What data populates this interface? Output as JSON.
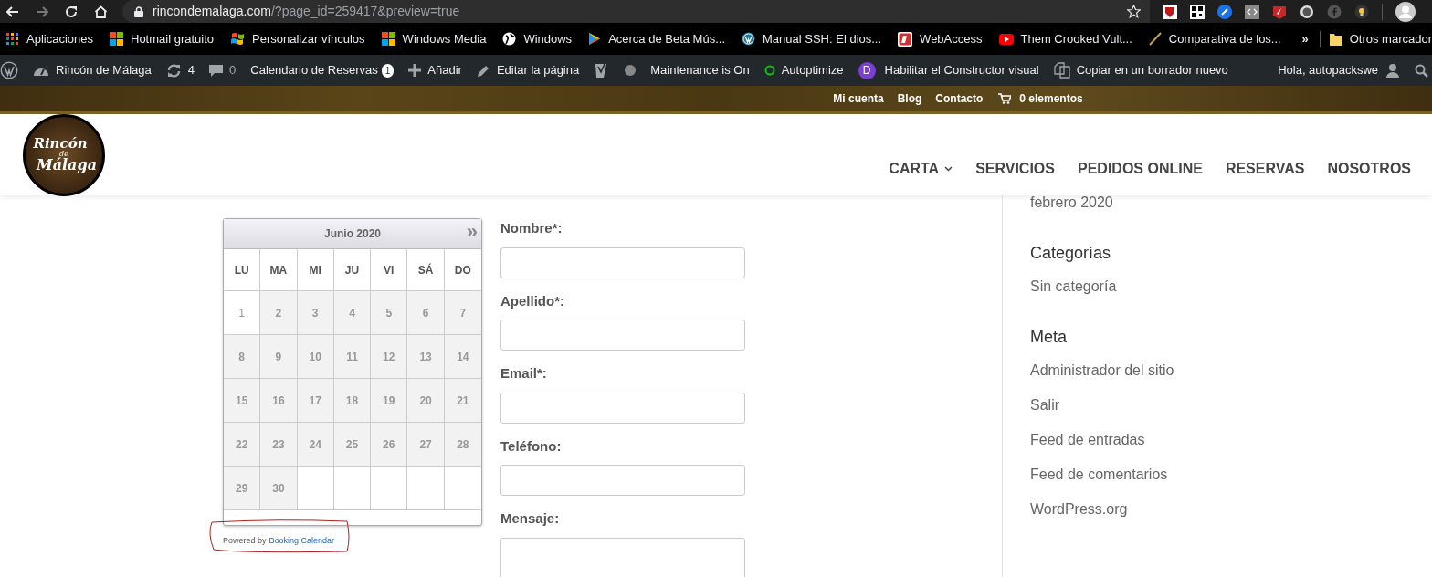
{
  "browser": {
    "url_host": "rincondemalaga.com",
    "url_path": "/?page_id=259417&preview=true",
    "bookmarks": [
      {
        "kind": "apps",
        "label": "Aplicaciones"
      },
      {
        "kind": "windows",
        "label": "Hotmail gratuito"
      },
      {
        "kind": "flag",
        "label": "Personalizar vínculos"
      },
      {
        "kind": "windows",
        "label": "Windows Media"
      },
      {
        "kind": "globe",
        "label": "Windows"
      },
      {
        "kind": "play",
        "label": "Acerca de Beta Mús..."
      },
      {
        "kind": "wp",
        "label": "Manual SSH: El dios..."
      },
      {
        "kind": "redbox",
        "label": "WebAccess"
      },
      {
        "kind": "youtube",
        "label": "Them Crooked Vult..."
      },
      {
        "kind": "slash",
        "label": "Comparativa de los..."
      }
    ],
    "more_bookmarks": "»",
    "other_bookmarks": "Otros marcador"
  },
  "admin_bar": {
    "site": "Rincón de Málaga",
    "updates": "4",
    "comments": "0",
    "calendar": "Calendario de Reservas",
    "calendar_badge": "1",
    "add": "Añadir",
    "edit": "Editar la página",
    "maintenance": "Maintenance is On",
    "autoptimize": "Autoptimize",
    "builder_icon": "D",
    "builder": "Habilitar el Constructor visual",
    "copy": "Copiar en un borrador nuevo",
    "greeting": "Hola, autopackswe"
  },
  "top_links": [
    "Mi cuenta",
    "Blog",
    "Contacto"
  ],
  "cart": "0 elementos",
  "logo": {
    "line1": "Rincón",
    "line2": "de",
    "line3": "Málaga"
  },
  "nav": [
    {
      "label": "CARTA",
      "has_submenu": true
    },
    {
      "label": "SERVICIOS",
      "has_submenu": false
    },
    {
      "label": "PEDIDOS ONLINE",
      "has_submenu": false
    },
    {
      "label": "RESERVAS",
      "has_submenu": false
    },
    {
      "label": "NOSOTROS",
      "has_submenu": false
    }
  ],
  "calendar": {
    "month": "Junio 2020",
    "next": "»",
    "weekdays": [
      "LU",
      "MA",
      "MI",
      "JU",
      "VI",
      "SÁ",
      "DO"
    ],
    "weeks": [
      [
        {
          "day": "1",
          "available": false
        },
        {
          "day": "2",
          "available": true
        },
        {
          "day": "3",
          "available": true
        },
        {
          "day": "4",
          "available": true
        },
        {
          "day": "5",
          "available": true
        },
        {
          "day": "6",
          "available": true
        },
        {
          "day": "7",
          "available": true
        }
      ],
      [
        {
          "day": "8",
          "available": true
        },
        {
          "day": "9",
          "available": true
        },
        {
          "day": "10",
          "available": true
        },
        {
          "day": "11",
          "available": true
        },
        {
          "day": "12",
          "available": true
        },
        {
          "day": "13",
          "available": true
        },
        {
          "day": "14",
          "available": true
        }
      ],
      [
        {
          "day": "15",
          "available": true
        },
        {
          "day": "16",
          "available": true
        },
        {
          "day": "17",
          "available": true
        },
        {
          "day": "18",
          "available": true
        },
        {
          "day": "19",
          "available": true
        },
        {
          "day": "20",
          "available": true
        },
        {
          "day": "21",
          "available": true
        }
      ],
      [
        {
          "day": "22",
          "available": true
        },
        {
          "day": "23",
          "available": true
        },
        {
          "day": "24",
          "available": true
        },
        {
          "day": "25",
          "available": true
        },
        {
          "day": "26",
          "available": true
        },
        {
          "day": "27",
          "available": true
        },
        {
          "day": "28",
          "available": true
        }
      ],
      [
        {
          "day": "29",
          "available": true
        },
        {
          "day": "30",
          "available": true
        }
      ]
    ],
    "powered_by": "Powered by",
    "powered_link": "Booking Calendar"
  },
  "form": [
    {
      "label": "Nombre*:"
    },
    {
      "label": "Apellido*:"
    },
    {
      "label": "Email*:"
    },
    {
      "label": "Teléfono:"
    },
    {
      "label": "Mensaje:",
      "kind": "textarea"
    }
  ],
  "sidebar": {
    "archive_item": "febrero 2020",
    "sections": [
      {
        "heading": "Categorías",
        "links": [
          "Sin categoría"
        ]
      },
      {
        "heading": "Meta",
        "links": [
          "Administrador del sitio",
          "Salir",
          "Feed de entradas",
          "Feed de comentarios",
          "WordPress.org"
        ]
      }
    ]
  }
}
